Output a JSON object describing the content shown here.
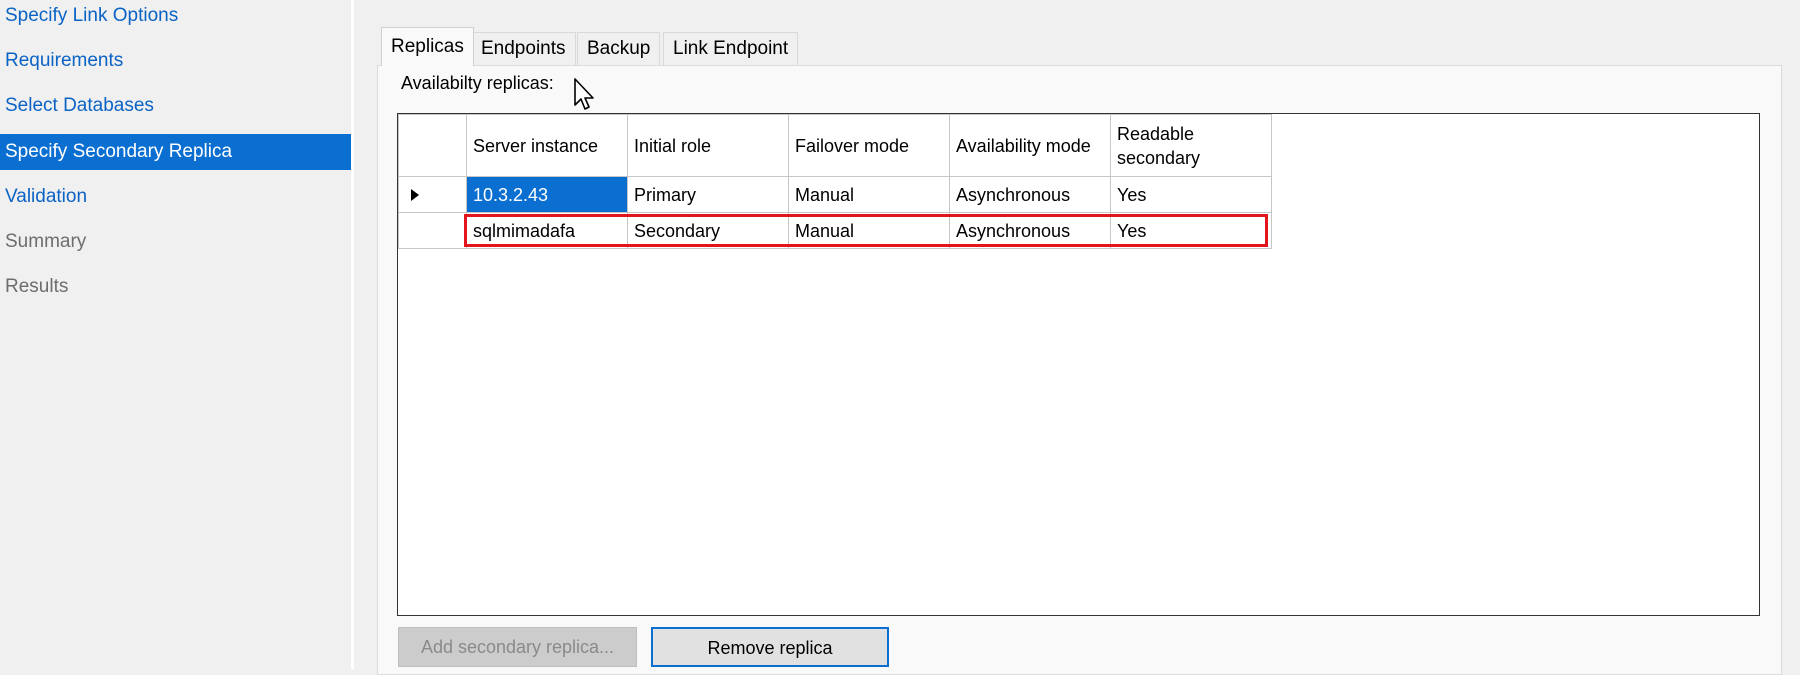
{
  "sidebar": {
    "items": [
      {
        "label": "Specify Link Options",
        "state": "link"
      },
      {
        "label": "Requirements",
        "state": "link"
      },
      {
        "label": "Select Databases",
        "state": "link"
      },
      {
        "label": "Specify Secondary Replica",
        "state": "active"
      },
      {
        "label": "Validation",
        "state": "link"
      },
      {
        "label": "Summary",
        "state": "disabled"
      },
      {
        "label": "Results",
        "state": "disabled"
      }
    ]
  },
  "tabs": [
    {
      "label": "Replicas",
      "active": true
    },
    {
      "label": "Endpoints",
      "active": false
    },
    {
      "label": "Backup",
      "active": false
    },
    {
      "label": "Link Endpoint",
      "active": false
    }
  ],
  "replicas": {
    "group_label": "Availabilty replicas:",
    "columns": [
      "Server instance",
      "Initial role",
      "Failover mode",
      "Availability mode",
      "Readable secondary"
    ],
    "rows": [
      [
        "10.3.2.43",
        "Primary",
        "Manual",
        "Asynchronous",
        "Yes"
      ],
      [
        "sqlmimadafa",
        "Secondary",
        "Manual",
        "Asynchronous",
        "Yes"
      ]
    ]
  },
  "buttons": {
    "add_secondary": "Add secondary replica...",
    "remove_replica": "Remove replica"
  },
  "colors": {
    "accent": "#0a6fd1",
    "link": "#0b63c5",
    "highlight": "#e2141c"
  }
}
